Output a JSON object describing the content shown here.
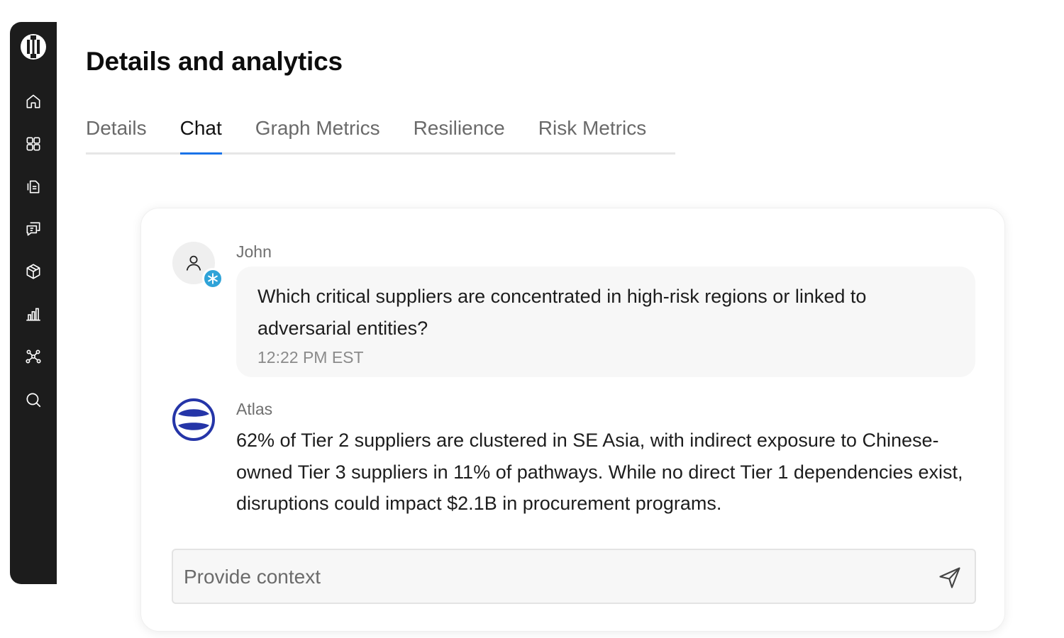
{
  "page": {
    "title": "Details and analytics"
  },
  "sidebar": {
    "icons": [
      "logo-icon",
      "home-icon",
      "grid-icon",
      "documents-icon",
      "chat-icon",
      "package-icon",
      "bar-chart-icon",
      "network-icon",
      "search-icon"
    ]
  },
  "tabs": [
    {
      "label": "Details",
      "active": false
    },
    {
      "label": "Chat",
      "active": true
    },
    {
      "label": "Graph Metrics",
      "active": false
    },
    {
      "label": "Resilience",
      "active": false
    },
    {
      "label": "Risk Metrics",
      "active": false
    }
  ],
  "colors": {
    "accent": "#1a73e8",
    "sidebar": "#1c1c1c",
    "badge": "#2fa3d8",
    "atlas_brand": "#2535a8"
  },
  "chat": {
    "messages": [
      {
        "sender": "John",
        "text": "Which critical suppliers are concentrated in high-risk regions or linked to adversarial entities?",
        "time": "12:22 PM EST"
      },
      {
        "sender": "Atlas",
        "text": "62% of Tier 2 suppliers are clustered in SE Asia, with indirect exposure to Chinese-owned Tier 3 suppliers in 11% of pathways. While no direct Tier 1 dependencies exist, disruptions could impact $2.1B in procurement programs."
      }
    ],
    "input": {
      "placeholder": "Provide context",
      "value": ""
    }
  }
}
